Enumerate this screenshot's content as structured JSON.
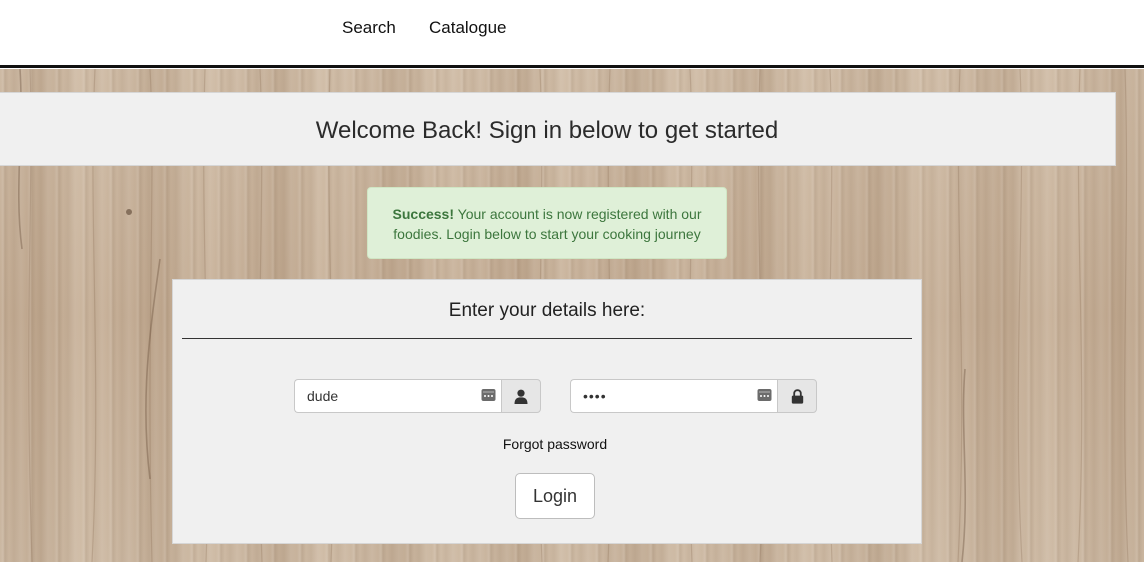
{
  "nav": {
    "items": [
      {
        "label": "Search"
      },
      {
        "label": "Catalogue"
      }
    ]
  },
  "welcome": {
    "title": "Welcome Back! Sign in below to get started"
  },
  "alert": {
    "strong": "Success!",
    "message": " Your account is now registered with our foodies. Login below to start your cooking journey",
    "color": "#3c763d",
    "background": "#dff0d8"
  },
  "login": {
    "title": "Enter your details here:",
    "username": {
      "value": "dude",
      "icon": "user-icon"
    },
    "password": {
      "value": "••••",
      "icon": "lock-icon"
    },
    "forgot_label": "Forgot password",
    "submit_label": "Login"
  }
}
